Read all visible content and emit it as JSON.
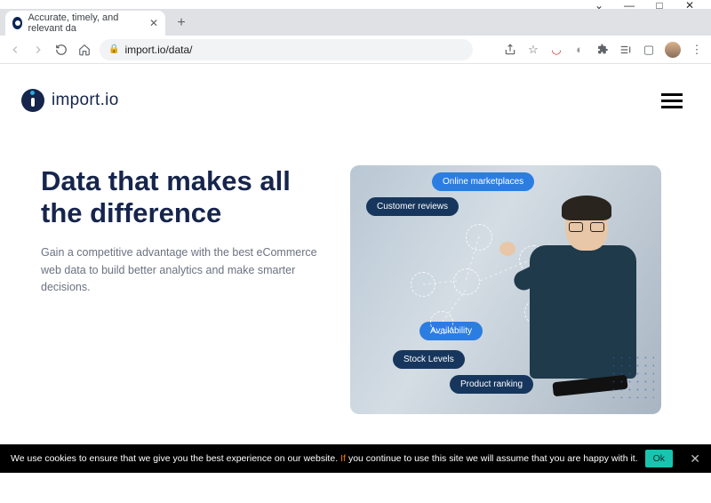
{
  "window": {
    "controls": {
      "dropdown": "⌄",
      "min": "—",
      "max": "□",
      "close": "✕"
    }
  },
  "tab": {
    "title": "Accurate, timely, and relevant da",
    "close": "✕",
    "newtab": "+"
  },
  "addr": {
    "url": "import.io/data/"
  },
  "brand": {
    "name": "import.io"
  },
  "hero": {
    "title": "Data that makes all the difference",
    "subtitle": "Gain a competitive advantage with the best eCommerce web data to build better analytics and make smarter decisions."
  },
  "pills": {
    "marketplaces": "Online marketplaces",
    "reviews": "Customer reviews",
    "availability": "Availability",
    "stock": "Stock Levels",
    "ranking": "Product ranking"
  },
  "cookie": {
    "text1": "We use cookies to ensure that we give you the best experience on our website.",
    "text2": "If",
    "text3": "you continue to use this site we will assume that you are happy with it.",
    "ok": "Ok",
    "close": "✕"
  }
}
